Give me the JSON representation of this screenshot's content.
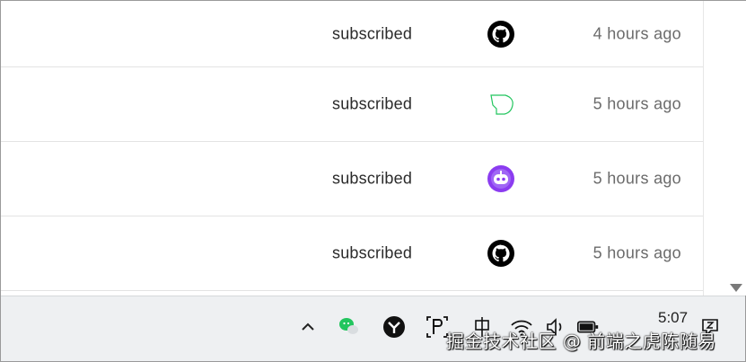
{
  "events": [
    {
      "action": "subscribed",
      "source_icon": "github-icon",
      "time": "4 hours ago"
    },
    {
      "action": "subscribed",
      "source_icon": "green-shape-icon",
      "time": "5 hours ago"
    },
    {
      "action": "subscribed",
      "source_icon": "purple-bot-icon",
      "time": "5 hours ago"
    },
    {
      "action": "subscribed",
      "source_icon": "github-icon",
      "time": "5 hours ago"
    }
  ],
  "taskbar": {
    "clock_time": "5:07",
    "watermark": "掘金技术社区 @ 前端之虎陈随易",
    "icons": [
      "chevron-up-icon",
      "wechat-icon",
      "app-icon",
      "parking-icon",
      "ime-icon",
      "wifi-icon",
      "volume-icon",
      "battery-icon",
      "notification-icon"
    ]
  },
  "colors": {
    "github": "#000000",
    "green_shape": "#22c55e",
    "purple_bot": "#8b3cf0",
    "wechat": "#22c55e"
  }
}
